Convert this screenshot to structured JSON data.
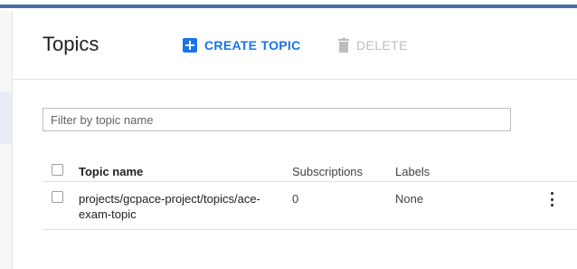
{
  "colors": {
    "accent": "#1a73e8",
    "top_stripe": "#4a6ea8",
    "disabled": "#bdbdbd"
  },
  "header": {
    "title": "Topics",
    "create_label": "CREATE TOPIC",
    "create_icon": "plus-box-icon",
    "delete_label": "DELETE",
    "delete_icon": "trash-icon"
  },
  "filter": {
    "placeholder": "Filter by topic name",
    "value": ""
  },
  "table": {
    "columns": [
      "Topic name",
      "Subscriptions",
      "Labels"
    ],
    "rows": [
      {
        "topic_name": "projects/gcpace-project/topics/ace-exam-topic",
        "subscriptions": "0",
        "labels": "None",
        "menu_icon": "more-vert-icon"
      }
    ]
  }
}
